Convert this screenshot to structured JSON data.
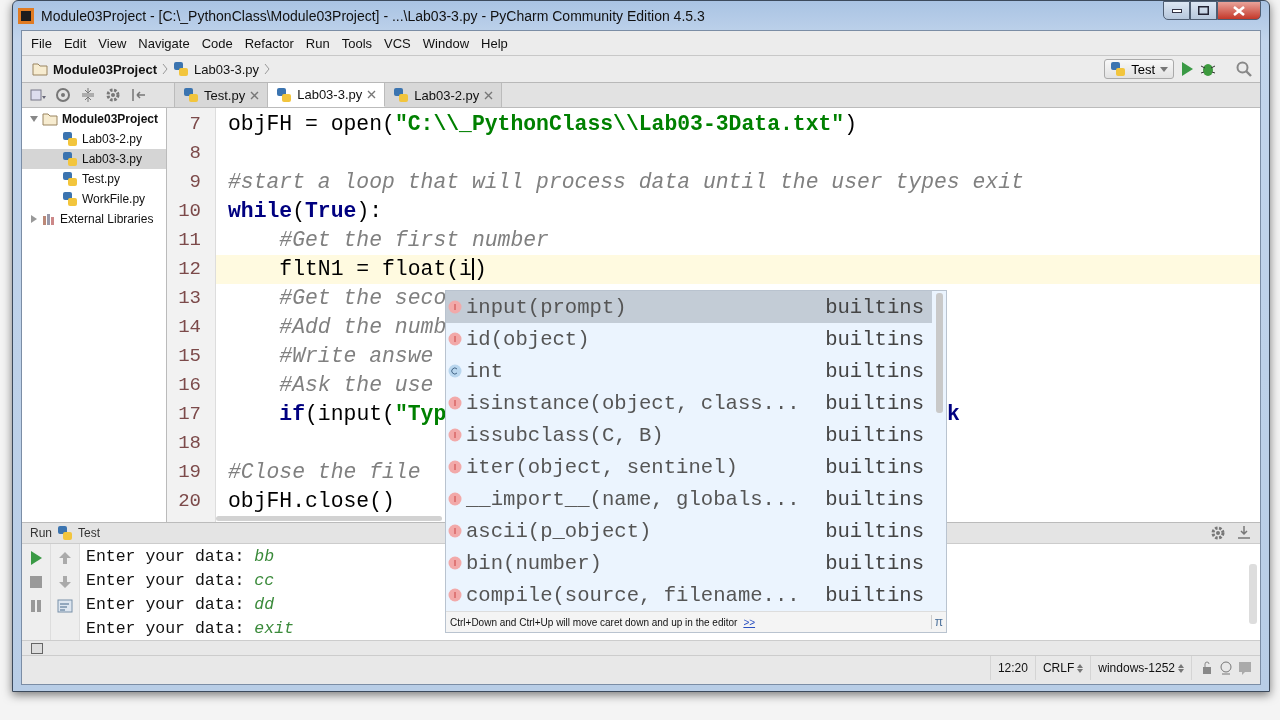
{
  "window": {
    "title": "Module03Project - [C:\\_PythonClass\\Module03Project] - ...\\Lab03-3.py - PyCharm Community Edition 4.5.3"
  },
  "menu": [
    "File",
    "Edit",
    "View",
    "Navigate",
    "Code",
    "Refactor",
    "Run",
    "Tools",
    "VCS",
    "Window",
    "Help"
  ],
  "breadcrumb": [
    "Module03Project",
    "Lab03-3.py"
  ],
  "run_config": "Test",
  "tabs": [
    {
      "label": "Test.py",
      "selected": false
    },
    {
      "label": "Lab03-3.py",
      "selected": true
    },
    {
      "label": "Lab03-2.py",
      "selected": false
    }
  ],
  "project_tree": [
    {
      "label": "Module03Project",
      "kind": "folder",
      "expanded": true,
      "selected": false,
      "children": [
        {
          "label": "Lab03-2.py",
          "kind": "file",
          "selected": false
        },
        {
          "label": "Lab03-3.py",
          "kind": "file",
          "selected": true
        },
        {
          "label": "Test.py",
          "kind": "file",
          "selected": false
        },
        {
          "label": "WorkFile.py",
          "kind": "file",
          "selected": false
        }
      ]
    },
    {
      "label": "External Libraries",
      "kind": "library",
      "expanded": false,
      "selected": false
    }
  ],
  "editor": {
    "lines": [
      {
        "number": "7",
        "current": false,
        "segments": [
          {
            "kind": "plain",
            "text": "objFH = open("
          },
          {
            "kind": "string",
            "text": "\"C:\\\\_PythonClass\\\\Lab03-3Data.txt\""
          },
          {
            "kind": "plain",
            "text": ")"
          }
        ]
      },
      {
        "number": "8",
        "current": false
      },
      {
        "number": "9",
        "current": false,
        "segments": [
          {
            "kind": "comment",
            "text": "#start a loop that will process data until the user types exit"
          }
        ]
      },
      {
        "number": "10",
        "current": false,
        "segments": [
          {
            "kind": "keyword",
            "text": "while"
          },
          {
            "kind": "plain",
            "text": "("
          },
          {
            "kind": "keyword",
            "text": "True"
          },
          {
            "kind": "plain",
            "text": "):"
          }
        ]
      },
      {
        "number": "11",
        "current": false,
        "segments": [
          {
            "kind": "comment",
            "text": "    #Get the first number"
          }
        ]
      },
      {
        "number": "12",
        "current": true,
        "segments": [
          {
            "kind": "plain",
            "text": "    fltN1 = float(i"
          },
          {
            "kind": "caret"
          },
          {
            "kind": "plain",
            "text": ")"
          }
        ]
      },
      {
        "number": "13",
        "current": false,
        "segments": [
          {
            "kind": "comment",
            "text": "    #Get the seco"
          }
        ]
      },
      {
        "number": "14",
        "current": false,
        "segments": [
          {
            "kind": "comment",
            "text": "    #Add the numb"
          }
        ]
      },
      {
        "number": "15",
        "current": false,
        "segments": [
          {
            "kind": "comment",
            "text": "    #Write answe"
          }
        ]
      },
      {
        "number": "16",
        "current": false,
        "segments": [
          {
            "kind": "comment",
            "text": "    #Ask the use"
          }
        ]
      },
      {
        "number": "17",
        "current": false,
        "segments": [
          {
            "kind": "keyword",
            "text": "    if"
          },
          {
            "kind": "plain",
            "text": "(input("
          },
          {
            "kind": "string",
            "text": "\"Typ"
          }
        ],
        "tail": {
          "kind": "keyword",
          "text": "k"
        }
      },
      {
        "number": "18",
        "current": false
      },
      {
        "number": "19",
        "current": false,
        "segments": [
          {
            "kind": "comment",
            "text": "#Close the file"
          }
        ]
      },
      {
        "number": "20",
        "current": false,
        "segments": [
          {
            "kind": "plain",
            "text": "objFH.close()"
          }
        ]
      }
    ]
  },
  "completion": {
    "items": [
      {
        "name": "input(prompt)",
        "source": "builtins",
        "kind": "function",
        "selected": true
      },
      {
        "name": "id(object)",
        "source": "builtins",
        "kind": "function",
        "selected": false
      },
      {
        "name": "int",
        "source": "builtins",
        "kind": "class",
        "selected": false
      },
      {
        "name": "isinstance(object, class...",
        "source": "builtins",
        "kind": "function",
        "selected": false
      },
      {
        "name": "issubclass(C, B)",
        "source": "builtins",
        "kind": "function",
        "selected": false
      },
      {
        "name": "iter(object, sentinel)",
        "source": "builtins",
        "kind": "function",
        "selected": false
      },
      {
        "name": "__import__(name, globals...",
        "source": "builtins",
        "kind": "function",
        "selected": false
      },
      {
        "name": "ascii(p_object)",
        "source": "builtins",
        "kind": "function",
        "selected": false
      },
      {
        "name": "bin(number)",
        "source": "builtins",
        "kind": "function",
        "selected": false
      },
      {
        "name": "compile(source, filename...",
        "source": "builtins",
        "kind": "function",
        "selected": false
      }
    ],
    "hint": "Ctrl+Down and Ctrl+Up will move caret down and up in the editor",
    "hint_link": ">>",
    "corner": "π"
  },
  "run_panel": {
    "title": "Run",
    "config": "Test",
    "lines": [
      {
        "prompt": "Enter your data:",
        "input": "bb"
      },
      {
        "prompt": "Enter your data:",
        "input": "cc"
      },
      {
        "prompt": "Enter your data:",
        "input": "dd"
      },
      {
        "prompt": "Enter your data:",
        "input": "exit"
      }
    ]
  },
  "status_bar": {
    "position": "12:20",
    "line_separator": "CRLF",
    "encoding": "windows-1252"
  }
}
